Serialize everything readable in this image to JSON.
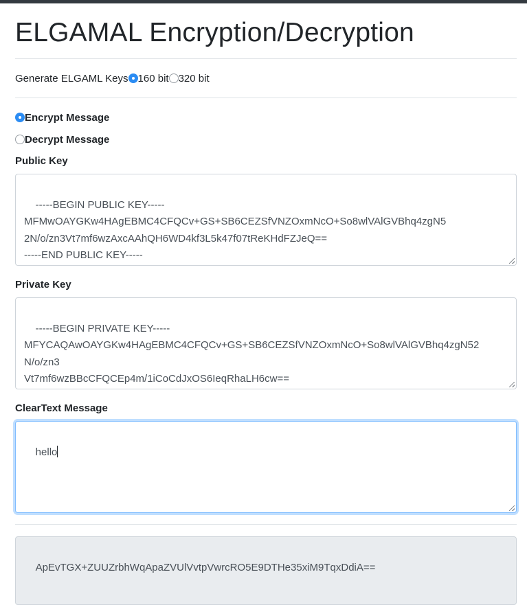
{
  "page": {
    "title": "ELGAMAL Encryption/Decryption"
  },
  "keygen": {
    "label": "Generate ELGAML Keys",
    "options": [
      {
        "label": "160 bit",
        "checked": true
      },
      {
        "label": "320 bit",
        "checked": false
      }
    ]
  },
  "mode": {
    "options": [
      {
        "label": "Encrypt Message",
        "checked": true
      },
      {
        "label": "Decrypt Message",
        "checked": false
      }
    ]
  },
  "public_key": {
    "label": "Public Key",
    "value": "-----BEGIN PUBLIC KEY-----\nMFMwOAYGKw4HAgEBMC4CFQCv+GS+SB6CEZSfVNZOxmNcO+So8wlVAlGVBhq4zgN5\n2N/o/zn3Vt7mf6wzAxcAAhQH6WD4kf3L5k47f07tReKHdFZJeQ==\n-----END PUBLIC KEY-----"
  },
  "private_key": {
    "label": "Private Key",
    "value": "-----BEGIN PRIVATE KEY-----\nMFYCAQAwOAYGKw4HAgEBMC4CFQCv+GS+SB6CEZSfVNZOxmNcO+So8wlVAlGVBhq4zgN52\nN/o/zn3\nVt7mf6wzBBcCFQCEp4m/1iCoCdJxOS6IeqRhaLH6cw==\n-----END PRIVATE KEY-----"
  },
  "cleartext": {
    "label": "ClearText Message",
    "value": "hello"
  },
  "output": {
    "value": "ApEvTGX+ZUUZrbhWqApaZVUlVvtpVwrcRO5E9DTHe35xiM9TqxDdiA=="
  }
}
